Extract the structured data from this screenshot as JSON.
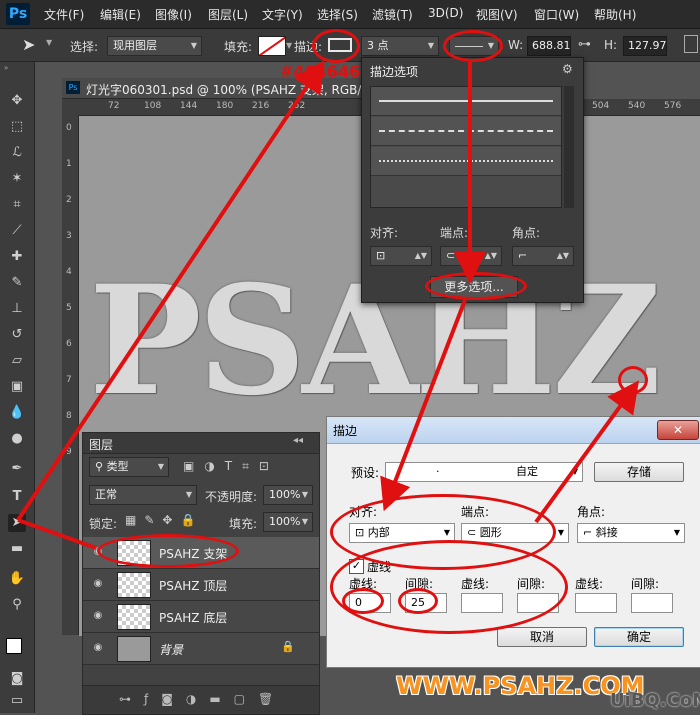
{
  "menubar": {
    "logo": "Ps",
    "items": [
      "文件(F)",
      "编辑(E)",
      "图像(I)",
      "图层(L)",
      "文字(Y)",
      "选择(S)",
      "滤镜(T)",
      "3D(D)",
      "视图(V)",
      "窗口(W)",
      "帮助(H)"
    ]
  },
  "options": {
    "select_label": "选择:",
    "select_value": "现用图层",
    "fill_label": "填充:",
    "stroke_label": "描边:",
    "stroke_width": "3 点",
    "w_label": "W:",
    "w_value": "688.81",
    "h_label": "H:",
    "h_value": "127.97",
    "color_annotation": "#464646"
  },
  "document": {
    "tab_title": "灯光字060301.psd @ 100% (PSAHZ 支架, RGB/8) *",
    "ruler_top": [
      "72",
      "108",
      "144",
      "180",
      "216",
      "252",
      "504",
      "540",
      "576"
    ],
    "ruler_left": [
      "0",
      "1",
      "2",
      "3",
      "4",
      "5",
      "6",
      "7",
      "8",
      "9"
    ],
    "canvas_text": "PSAHZ",
    "canvas_color": "#9a9a9a"
  },
  "stroke_popup": {
    "title": "描边选项",
    "align_label": "对齐:",
    "cap_label": "端点:",
    "corner_label": "角点:",
    "more_button": "更多选项..."
  },
  "layers": {
    "tab": "图层",
    "filter_kind": "类型",
    "blend_mode": "正常",
    "opacity_label": "不透明度:",
    "opacity_value": "100%",
    "lock_label": "锁定:",
    "fill_label": "填充:",
    "fill_value": "100%",
    "rows": [
      {
        "name": "PSAHZ 支架",
        "selected": true
      },
      {
        "name": "PSAHZ 顶层",
        "selected": false
      },
      {
        "name": "PSAHZ 底层",
        "selected": false
      },
      {
        "name": "背景",
        "selected": false
      }
    ]
  },
  "stroke_dialog": {
    "title": "描边",
    "preset_label": "预设:",
    "preset_value": "自定",
    "save_button": "存储",
    "align_label": "对齐:",
    "align_value": "内部",
    "cap_label": "端点:",
    "cap_value": "圆形",
    "corner_label": "角点:",
    "corner_value": "斜接",
    "dashed_label": "虚线",
    "dashed_checked": true,
    "fields": [
      {
        "label": "虚线:",
        "value": "0"
      },
      {
        "label": "间隙:",
        "value": "25"
      },
      {
        "label": "虚线:",
        "value": ""
      },
      {
        "label": "间隙:",
        "value": ""
      },
      {
        "label": "虚线:",
        "value": ""
      },
      {
        "label": "间隙:",
        "value": ""
      }
    ],
    "cancel_button": "取消",
    "ok_button": "确定"
  },
  "watermark": {
    "main": "WWW.PSAHZ.COM",
    "sub": "UiBQ.CoM"
  },
  "colors": {
    "annotation_red": "#e01010",
    "dialog_ok_border": "#3c7fb1"
  }
}
